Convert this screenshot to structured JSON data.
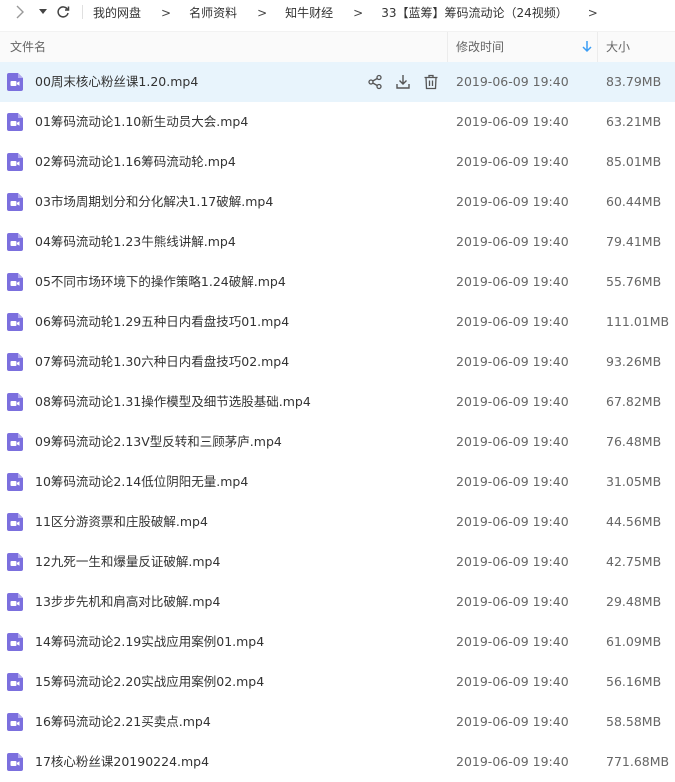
{
  "toolbar": {
    "breadcrumbs": [
      {
        "label": "我的网盘"
      },
      {
        "label": "名师资料"
      },
      {
        "label": "知牛财经"
      },
      {
        "label": "33【蓝筹】筹码流动论（24视频）"
      }
    ],
    "separator": ">"
  },
  "header": {
    "name_col": "文件名",
    "date_col": "修改时间",
    "size_col": "大小"
  },
  "files": [
    {
      "name": "00周末核心粉丝课1.20.mp4",
      "date": "2019-06-09 19:40",
      "size": "83.79MB"
    },
    {
      "name": "01筹码流动论1.10新生动员大会.mp4",
      "date": "2019-06-09 19:40",
      "size": "63.21MB"
    },
    {
      "name": "02筹码流动论1.16筹码流动轮.mp4",
      "date": "2019-06-09 19:40",
      "size": "85.01MB"
    },
    {
      "name": "03市场周期划分和分化解决1.17破解.mp4",
      "date": "2019-06-09 19:40",
      "size": "60.44MB"
    },
    {
      "name": "04筹码流动轮1.23牛熊线讲解.mp4",
      "date": "2019-06-09 19:40",
      "size": "79.41MB"
    },
    {
      "name": "05不同市场环境下的操作策略1.24破解.mp4",
      "date": "2019-06-09 19:40",
      "size": "55.76MB"
    },
    {
      "name": "06筹码流动轮1.29五种日内看盘技巧01.mp4",
      "date": "2019-06-09 19:40",
      "size": "111.01MB"
    },
    {
      "name": "07筹码流动轮1.30六种日内看盘技巧02.mp4",
      "date": "2019-06-09 19:40",
      "size": "93.26MB"
    },
    {
      "name": "08筹码流动论1.31操作模型及细节选股基础.mp4",
      "date": "2019-06-09 19:40",
      "size": "67.82MB"
    },
    {
      "name": "09筹码流动论2.13V型反转和三顾茅庐.mp4",
      "date": "2019-06-09 19:40",
      "size": "76.48MB"
    },
    {
      "name": "10筹码流动论2.14低位阴阳无量.mp4",
      "date": "2019-06-09 19:40",
      "size": "31.05MB"
    },
    {
      "name": "11区分游资票和庄股破解.mp4",
      "date": "2019-06-09 19:40",
      "size": "44.56MB"
    },
    {
      "name": "12九死一生和爆量反证破解.mp4",
      "date": "2019-06-09 19:40",
      "size": "42.75MB"
    },
    {
      "name": "13步步先机和肩高对比破解.mp4",
      "date": "2019-06-09 19:40",
      "size": "29.48MB"
    },
    {
      "name": "14筹码流动论2.19实战应用案例01.mp4",
      "date": "2019-06-09 19:40",
      "size": "61.09MB"
    },
    {
      "name": "15筹码流动论2.20实战应用案例02.mp4",
      "date": "2019-06-09 19:40",
      "size": "56.16MB"
    },
    {
      "name": "16筹码流动论2.21买卖点.mp4",
      "date": "2019-06-09 19:40",
      "size": "58.58MB"
    },
    {
      "name": "17核心粉丝课20190224.mp4",
      "date": "2019-06-09 19:40",
      "size": "771.68MB"
    }
  ],
  "colors": {
    "icon_purple": "#7b6fde",
    "selected_row": "#e8f4fc",
    "sort_arrow": "#3b9df5"
  },
  "icons": {
    "row_actions": [
      "share-icon",
      "download-icon",
      "delete-icon"
    ],
    "file": "video-file-icon"
  }
}
